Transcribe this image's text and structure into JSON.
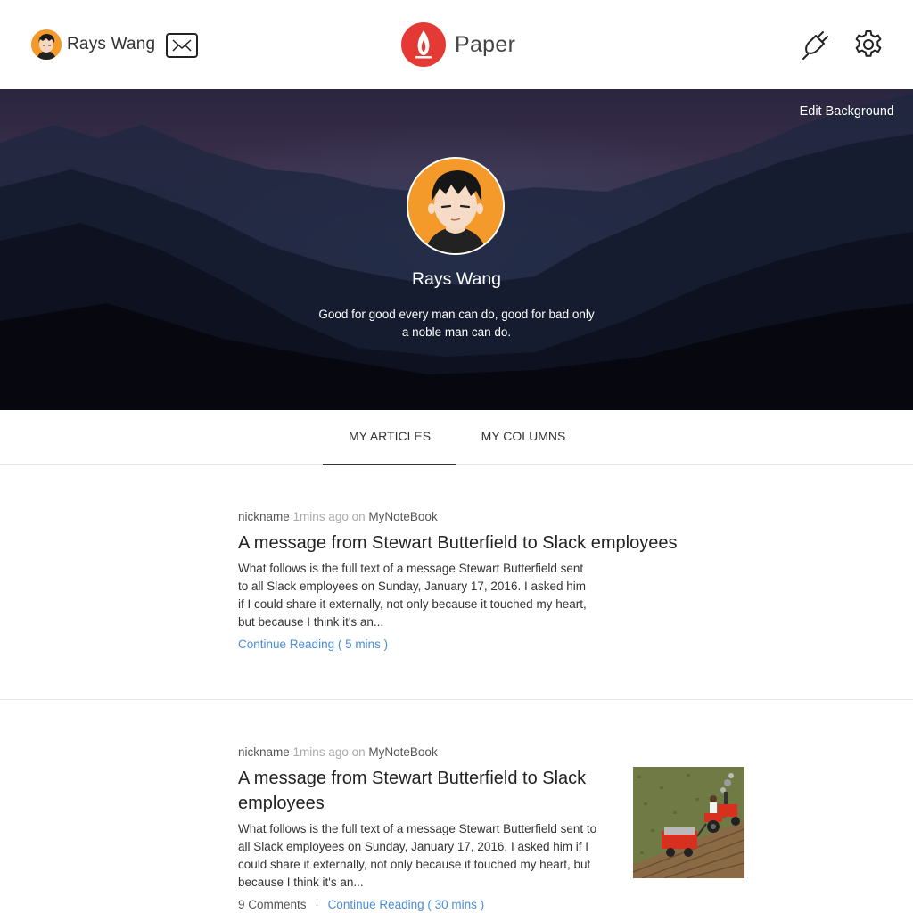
{
  "header": {
    "user_name": "Rays Wang",
    "brand_name": "Paper"
  },
  "hero": {
    "edit_background": "Edit Background",
    "name": "Rays Wang",
    "bio": "Good for good every man can do, good for bad only a noble man can do."
  },
  "tabs": [
    {
      "label": "MY ARTICLES",
      "active": true
    },
    {
      "label": "MY COLUMNS",
      "active": false
    }
  ],
  "articles": [
    {
      "author": "nickname",
      "time": "1mins ago",
      "on": "on",
      "notebook": "MyNoteBook",
      "title": "A message from Stewart Butterfield to Slack employees",
      "excerpt": "What follows is the full text of a message Stewart Butterfield sent to all Slack employees on Sunday, January 17, 2016. I asked him if I could share it externally, not only because it touched my heart, but because I think it's an...",
      "read_link": "Continue Reading ( 5 mins )"
    },
    {
      "author": "nickname",
      "time": "1mins ago",
      "on": "on",
      "notebook": "MyNoteBook",
      "title": "A message from Stewart Butterfield to Slack employees",
      "excerpt": "What follows is the full text of a message Stewart Butterfield sent to all Slack employees on Sunday, January 17, 2016. I asked him if I could share it externally, not only because it touched my heart, but because I think it's an...",
      "comments": "9 Comments",
      "separator": "·",
      "read_link": "Continue Reading ( 30 mins )",
      "thumbnail": "tractor-illustration"
    }
  ],
  "colors": {
    "accent": "#4a8dd8",
    "brand": "#e53935",
    "avatar_bg": "#f39a2b",
    "divider": "#e6e6e6"
  }
}
